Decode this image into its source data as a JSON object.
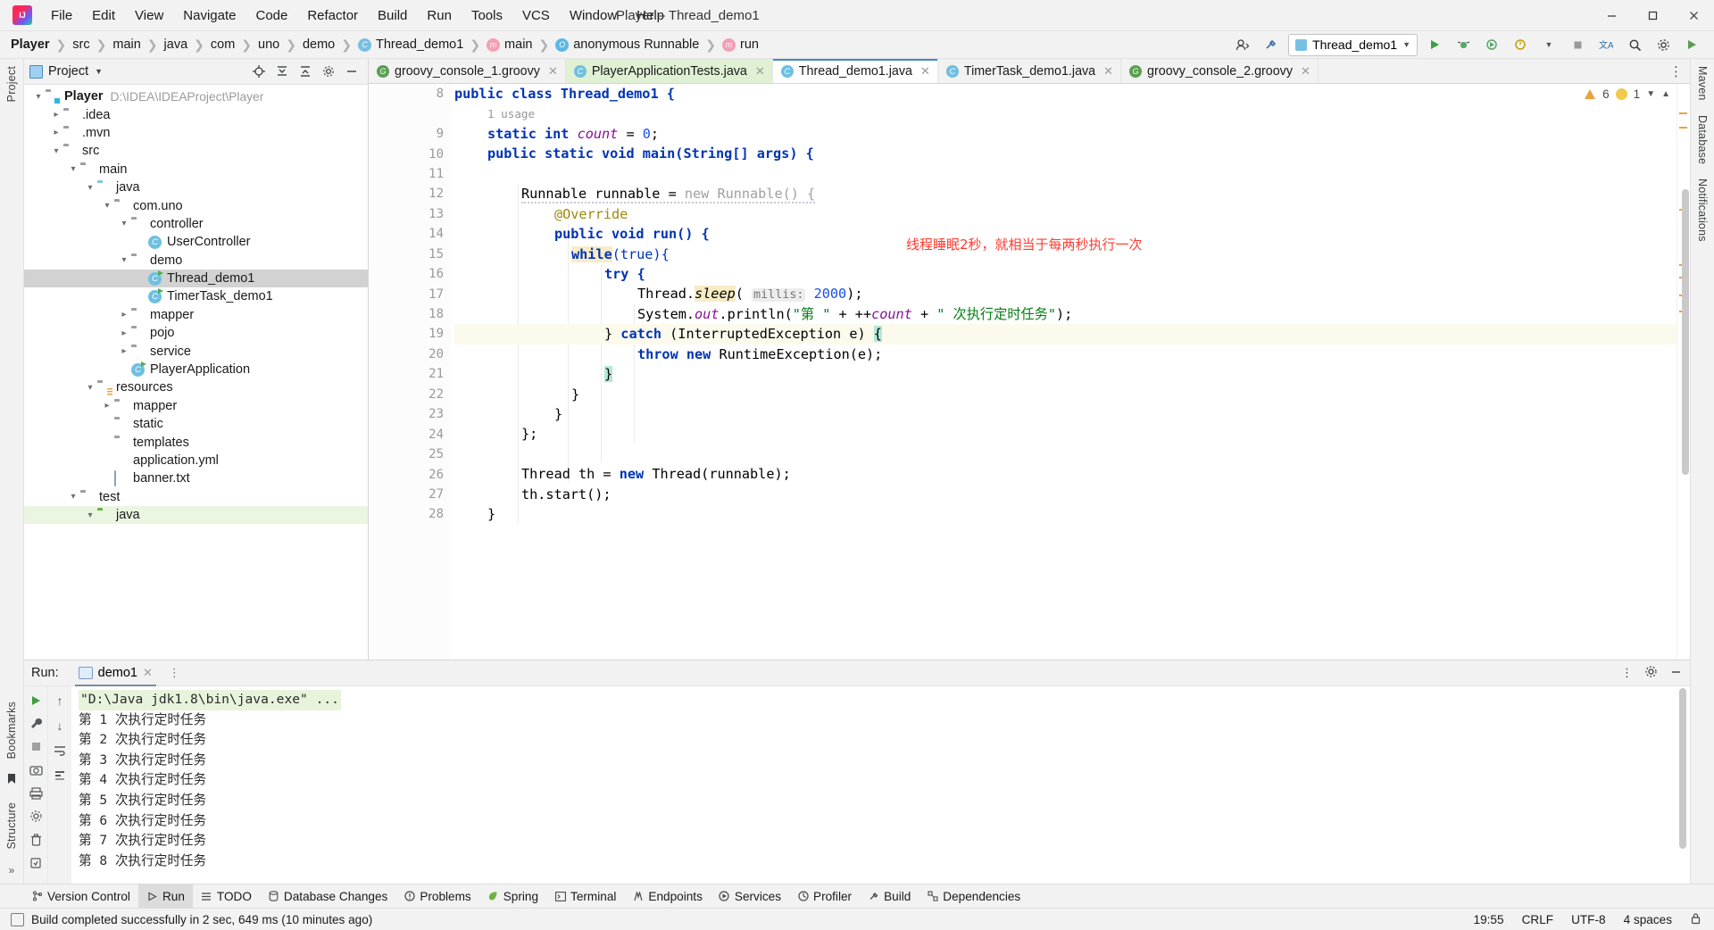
{
  "window": {
    "title": "Player – Thread_demo1",
    "app_logo": "intellij-idea-logo",
    "minimize": "—",
    "maximize": "▢",
    "close": "✕"
  },
  "menu": [
    {
      "label": "File"
    },
    {
      "label": "Edit"
    },
    {
      "label": "View"
    },
    {
      "label": "Navigate"
    },
    {
      "label": "Code"
    },
    {
      "label": "Refactor"
    },
    {
      "label": "Build"
    },
    {
      "label": "Run"
    },
    {
      "label": "Tools"
    },
    {
      "label": "VCS"
    },
    {
      "label": "Window"
    },
    {
      "label": "Help"
    }
  ],
  "breadcrumbs": [
    {
      "label": "Player",
      "icon": "",
      "bold": true
    },
    {
      "label": "src",
      "icon": ""
    },
    {
      "label": "main",
      "icon": ""
    },
    {
      "label": "java",
      "icon": ""
    },
    {
      "label": "com",
      "icon": ""
    },
    {
      "label": "uno",
      "icon": ""
    },
    {
      "label": "demo",
      "icon": ""
    },
    {
      "label": "Thread_demo1",
      "icon": "class-icon"
    },
    {
      "label": "main",
      "icon": "method-icon"
    },
    {
      "label": "anonymous Runnable",
      "icon": "interface-icon"
    },
    {
      "label": "run",
      "icon": "method-icon"
    }
  ],
  "navbar_right": {
    "user_icon": "account-icon",
    "build_icon": "hammer-icon",
    "run_config": "Thread_demo1",
    "run_icon": "run-icon",
    "debug_icon": "debug-icon",
    "coverage_icon": "coverage-icon",
    "profile_icon": "profile-icon",
    "stop_icon": "stop-icon",
    "translate_icon": "translate-icon",
    "search_icon": "search-icon",
    "settings_icon": "gear-icon",
    "updates_icon": "updates-icon"
  },
  "left_rail": [
    "Project",
    "Bookmarks",
    "Structure"
  ],
  "right_rail": [
    "Maven",
    "Database",
    "Notifications"
  ],
  "project_panel": {
    "title": "Project",
    "dropdown_icon": "chevron-down-icon",
    "actions": [
      "target-icon",
      "collapse-all-icon",
      "expand-icon",
      "gear-icon",
      "hide-icon"
    ],
    "tree": [
      {
        "depth": 0,
        "arrow": "expanded",
        "icon": "module-folder",
        "label": "Player",
        "bold": true,
        "path": "D:\\IDEA\\IDEAProject\\Player"
      },
      {
        "depth": 1,
        "arrow": "collapsed",
        "icon": "folder",
        "label": ".idea"
      },
      {
        "depth": 1,
        "arrow": "collapsed",
        "icon": "folder",
        "label": ".mvn"
      },
      {
        "depth": 1,
        "arrow": "expanded",
        "icon": "folder",
        "label": "src"
      },
      {
        "depth": 2,
        "arrow": "expanded",
        "icon": "folder",
        "label": "main"
      },
      {
        "depth": 3,
        "arrow": "expanded",
        "icon": "source-folder",
        "label": "java"
      },
      {
        "depth": 4,
        "arrow": "expanded",
        "icon": "package",
        "label": "com.uno"
      },
      {
        "depth": 5,
        "arrow": "expanded",
        "icon": "package",
        "label": "controller"
      },
      {
        "depth": 6,
        "arrow": "none",
        "icon": "java-class",
        "label": "UserController"
      },
      {
        "depth": 5,
        "arrow": "expanded",
        "icon": "package",
        "label": "demo"
      },
      {
        "depth": 6,
        "arrow": "none",
        "icon": "java-class-runnable",
        "label": "Thread_demo1",
        "selected": true
      },
      {
        "depth": 6,
        "arrow": "none",
        "icon": "java-class-runnable",
        "label": "TimerTask_demo1"
      },
      {
        "depth": 5,
        "arrow": "collapsed",
        "icon": "package",
        "label": "mapper"
      },
      {
        "depth": 5,
        "arrow": "collapsed",
        "icon": "package",
        "label": "pojo"
      },
      {
        "depth": 5,
        "arrow": "collapsed",
        "icon": "package",
        "label": "service"
      },
      {
        "depth": 5,
        "arrow": "none",
        "icon": "spring-class",
        "label": "PlayerApplication"
      },
      {
        "depth": 3,
        "arrow": "expanded",
        "icon": "resource-folder",
        "label": "resources"
      },
      {
        "depth": 4,
        "arrow": "collapsed",
        "icon": "folder",
        "label": "mapper"
      },
      {
        "depth": 4,
        "arrow": "none",
        "icon": "folder",
        "label": "static"
      },
      {
        "depth": 4,
        "arrow": "none",
        "icon": "folder",
        "label": "templates"
      },
      {
        "depth": 4,
        "arrow": "none",
        "icon": "yaml-file",
        "label": "application.yml"
      },
      {
        "depth": 4,
        "arrow": "none",
        "icon": "text-file",
        "label": "banner.txt"
      },
      {
        "depth": 2,
        "arrow": "expanded",
        "icon": "folder",
        "label": "test"
      },
      {
        "depth": 3,
        "arrow": "expanded",
        "icon": "test-source-folder",
        "label": "java",
        "green": true
      }
    ]
  },
  "editor": {
    "tabs": [
      {
        "label": "groovy_console_1.groovy",
        "icon": "groovy-icon",
        "state": "normal"
      },
      {
        "label": "PlayerApplicationTests.java",
        "icon": "class-icon",
        "state": "green"
      },
      {
        "label": "Thread_demo1.java",
        "icon": "class-icon",
        "state": "active"
      },
      {
        "label": "TimerTask_demo1.java",
        "icon": "class-icon",
        "state": "normal"
      },
      {
        "label": "groovy_console_2.groovy",
        "icon": "groovy-icon",
        "state": "normal"
      }
    ],
    "inspection": {
      "warnings": "6",
      "weak_warnings": "1",
      "warn_icon": "warning-triangle-icon",
      "weak_icon": "weak-warning-icon"
    },
    "usage_hint": "1 usage",
    "red_annotation": "线程睡眠2秒，就相当于每两秒执行一次",
    "lines": [
      {
        "no": "8",
        "run": true,
        "fold": false
      },
      {
        "no": "",
        "run": false,
        "fold": false
      },
      {
        "no": "9",
        "run": false,
        "fold": false
      },
      {
        "no": "10",
        "run": true,
        "fold": true
      },
      {
        "no": "11",
        "run": false,
        "fold": false
      },
      {
        "no": "12",
        "run": false,
        "fold": true
      },
      {
        "no": "13",
        "run": false,
        "fold": false
      },
      {
        "no": "14",
        "run": false,
        "fold": true,
        "marker": "override-icon"
      },
      {
        "no": "15",
        "run": false,
        "fold": true
      },
      {
        "no": "16",
        "run": false,
        "fold": true
      },
      {
        "no": "17",
        "run": false,
        "fold": false
      },
      {
        "no": "18",
        "run": false,
        "fold": false
      },
      {
        "no": "19",
        "run": false,
        "fold": false
      },
      {
        "no": "20",
        "run": false,
        "fold": false
      },
      {
        "no": "21",
        "run": false,
        "fold": false
      },
      {
        "no": "22",
        "run": false,
        "fold": false
      },
      {
        "no": "23",
        "run": false,
        "fold": false
      },
      {
        "no": "24",
        "run": false,
        "fold": false
      },
      {
        "no": "25",
        "run": false,
        "fold": false
      },
      {
        "no": "26",
        "run": false,
        "fold": false
      },
      {
        "no": "27",
        "run": false,
        "fold": false
      },
      {
        "no": "28",
        "run": false,
        "fold": true
      }
    ],
    "code": {
      "l8": "public class Thread_demo1 {",
      "l9_kw": "static int",
      "l9_field": "count",
      "l9_val": "0",
      "l10": "public static void main(String[] args) {",
      "l12_a": "Runnable runnable = ",
      "l12_b": "new Runnable() {",
      "l13": "@Override",
      "l14": "public void run() {",
      "l15a": "while",
      "l15b": "(true){",
      "l16": "try {",
      "l17a": "Thread.",
      "l17b": "sleep",
      "l17hint": "millis:",
      "l17num": "2000",
      "l18a": "System.",
      "l18b": "out",
      "l18c": ".println(",
      "l18str1": "\"第 \"",
      "l18d": " + ++",
      "l18field": "count",
      "l18e": " + ",
      "l18str2": "\" 次执行定时任务\"",
      "l18f": ");",
      "l19a": "} ",
      "l19b": "catch",
      "l19c": " (InterruptedException e) ",
      "l19d": "{",
      "l20a": "throw new",
      "l20b": " RuntimeException(e);",
      "l21": "}",
      "l22": "}",
      "l23": "}",
      "l24": "};",
      "l26a": "Thread th = ",
      "l26b": "new",
      "l26c": " Thread(runnable);",
      "l27": "th.start();",
      "l28": "}"
    }
  },
  "run_window": {
    "label": "Run:",
    "tab": "demo1",
    "tab_icon": "console-icon",
    "close_icon": "close-icon",
    "more_icon": "more-vertical-icon",
    "settings_icon": "gear-icon",
    "hide_icon": "minimize-icon",
    "left_tools": [
      "rerun-icon",
      "wrench-icon",
      "stop-icon",
      "trash-icon"
    ],
    "nav_tools": [
      "up-arrow-icon",
      "down-arrow-icon",
      "soft-wrap-icon",
      "scroll-end-icon",
      "print-icon",
      "settings-icon",
      "export-icon"
    ],
    "console_lines": [
      {
        "text": "\"D:\\Java jdk1.8\\bin\\java.exe\" ...",
        "highlight": true
      },
      {
        "text": "第 1 次执行定时任务"
      },
      {
        "text": "第 2 次执行定时任务"
      },
      {
        "text": "第 3 次执行定时任务"
      },
      {
        "text": "第 4 次执行定时任务"
      },
      {
        "text": "第 5 次执行定时任务"
      },
      {
        "text": "第 6 次执行定时任务"
      },
      {
        "text": "第 7 次执行定时任务"
      },
      {
        "text": "第 8 次执行定时任务"
      }
    ]
  },
  "bottom_toolbar": [
    {
      "label": "Version Control",
      "icon": "branch-icon"
    },
    {
      "label": "Run",
      "icon": "play-icon",
      "active": true
    },
    {
      "label": "TODO",
      "icon": "list-icon"
    },
    {
      "label": "Database Changes",
      "icon": "database-icon"
    },
    {
      "label": "Problems",
      "icon": "problems-icon"
    },
    {
      "label": "Spring",
      "icon": "spring-leaf-icon"
    },
    {
      "label": "Terminal",
      "icon": "terminal-icon"
    },
    {
      "label": "Endpoints",
      "icon": "endpoints-icon"
    },
    {
      "label": "Services",
      "icon": "services-icon"
    },
    {
      "label": "Profiler",
      "icon": "profiler-icon"
    },
    {
      "label": "Build",
      "icon": "build-icon"
    },
    {
      "label": "Dependencies",
      "icon": "dependencies-icon"
    }
  ],
  "status_bar": {
    "icon": "build-status-icon",
    "message": "Build completed successfully in 2 sec, 649 ms (10 minutes ago)",
    "time": "19:55",
    "line_sep": "CRLF",
    "encoding": "UTF-8",
    "indent": "4 spaces",
    "lock_icon": "lock-icon"
  }
}
